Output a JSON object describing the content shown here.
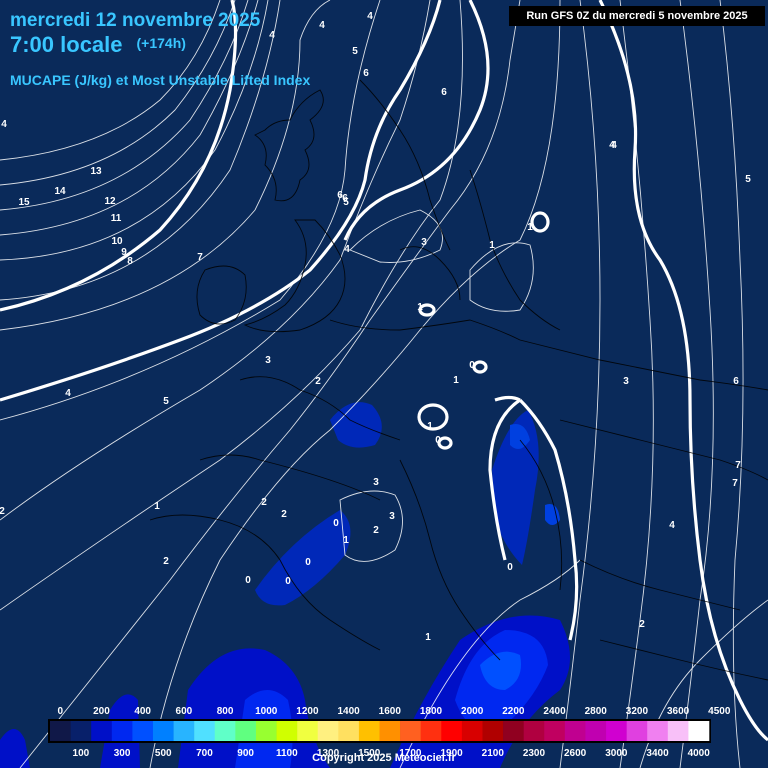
{
  "header": {
    "date_line": "mercredi 12 novembre 2025",
    "time_line": "7:00 locale",
    "forecast_hour": "(+174h)",
    "parameter": "MUCAPE (J/kg) et Most Unstable Lifted Index",
    "run_info": "Run GFS 0Z du mercredi 5 novembre 2025"
  },
  "legend": {
    "top_labels": [
      "0",
      "200",
      "400",
      "600",
      "800",
      "1000",
      "1200",
      "1400",
      "1600",
      "1800",
      "2000",
      "2200",
      "2400",
      "2800",
      "3200",
      "3600",
      "4500"
    ],
    "bottom_labels": [
      "100",
      "300",
      "500",
      "700",
      "900",
      "1100",
      "1300",
      "1500",
      "1700",
      "1900",
      "2100",
      "2300",
      "2600",
      "3000",
      "3400",
      "4000"
    ],
    "colors": [
      "#101848",
      "#08206a",
      "#0010c8",
      "#0028f0",
      "#0050ff",
      "#0080ff",
      "#28b4ff",
      "#50e0ff",
      "#60ffc8",
      "#60ff80",
      "#98ff30",
      "#d0ff00",
      "#f0ff40",
      "#fff080",
      "#ffe060",
      "#ffc000",
      "#ff9000",
      "#ff6020",
      "#ff3010",
      "#ff0000",
      "#d80000",
      "#b00000",
      "#900020",
      "#b00040",
      "#c00060",
      "#c00090",
      "#c000b0",
      "#d000d0",
      "#e040e0",
      "#f080f0",
      "#f8c0f8",
      "#ffffff"
    ]
  },
  "contour_labels": [
    "4",
    "4",
    "5",
    "6",
    "6",
    "4",
    "6",
    "4",
    "13",
    "14",
    "15",
    "12",
    "11",
    "10",
    "9",
    "8",
    "7",
    "6",
    "5",
    "4",
    "3",
    "1",
    "1",
    "2",
    "3",
    "1",
    "0",
    "1",
    "4",
    "5",
    "4",
    "3",
    "5",
    "6",
    "7",
    "7",
    "4",
    "2",
    "1",
    "2",
    "2",
    "3",
    "3",
    "2",
    "1",
    "0",
    "0",
    "0",
    "0",
    "1",
    "0",
    "0",
    "2",
    "1",
    "2",
    "4"
  ],
  "copyright": "Copyright 2025 Meteociel.fr"
}
